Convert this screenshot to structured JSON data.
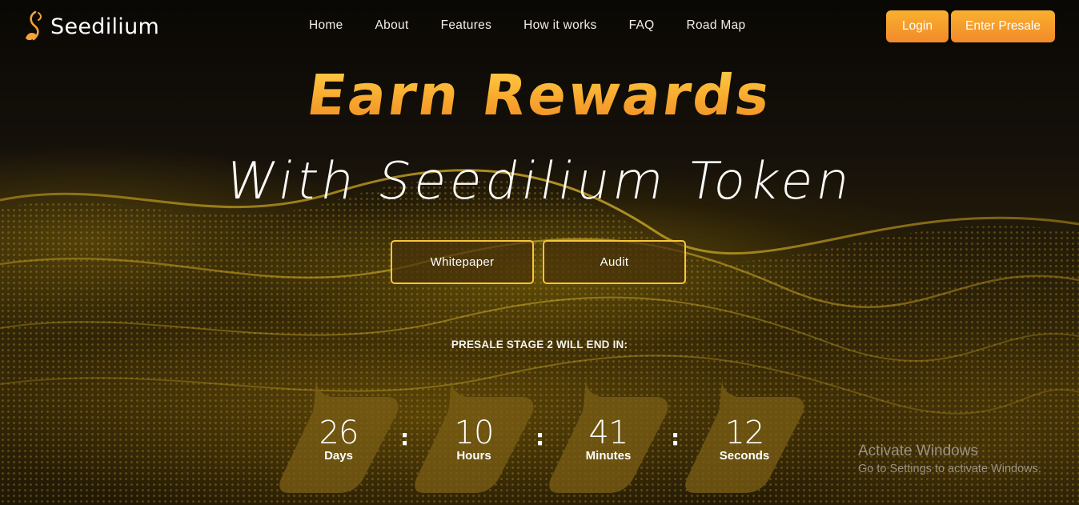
{
  "brand": {
    "name": "Seedilium"
  },
  "nav": {
    "items": [
      {
        "label": "Home"
      },
      {
        "label": "About"
      },
      {
        "label": "Features"
      },
      {
        "label": "How it works"
      },
      {
        "label": "FAQ"
      },
      {
        "label": "Road Map"
      }
    ]
  },
  "header": {
    "login_label": "Login",
    "presale_label": "Enter Presale"
  },
  "hero": {
    "title": "Earn Rewards",
    "subtitle": "With Seedilium Token",
    "whitepaper_label": "Whitepaper",
    "audit_label": "Audit"
  },
  "countdown": {
    "heading": "PRESALE STAGE 2 WILL END IN:",
    "separator": ":",
    "units": [
      {
        "value": "26",
        "label": "Days"
      },
      {
        "value": "10",
        "label": "Hours"
      },
      {
        "value": "41",
        "label": "Minutes"
      },
      {
        "value": "12",
        "label": "Seconds"
      }
    ]
  },
  "watermark": {
    "title": "Activate Windows",
    "subtitle": "Go to Settings to activate Windows."
  },
  "colors": {
    "accent_orange": "#f7a52c",
    "outline_gold": "#f7c638",
    "background_dark": "#0b0803"
  },
  "icons": {
    "brand": "seedling-flame-icon"
  }
}
